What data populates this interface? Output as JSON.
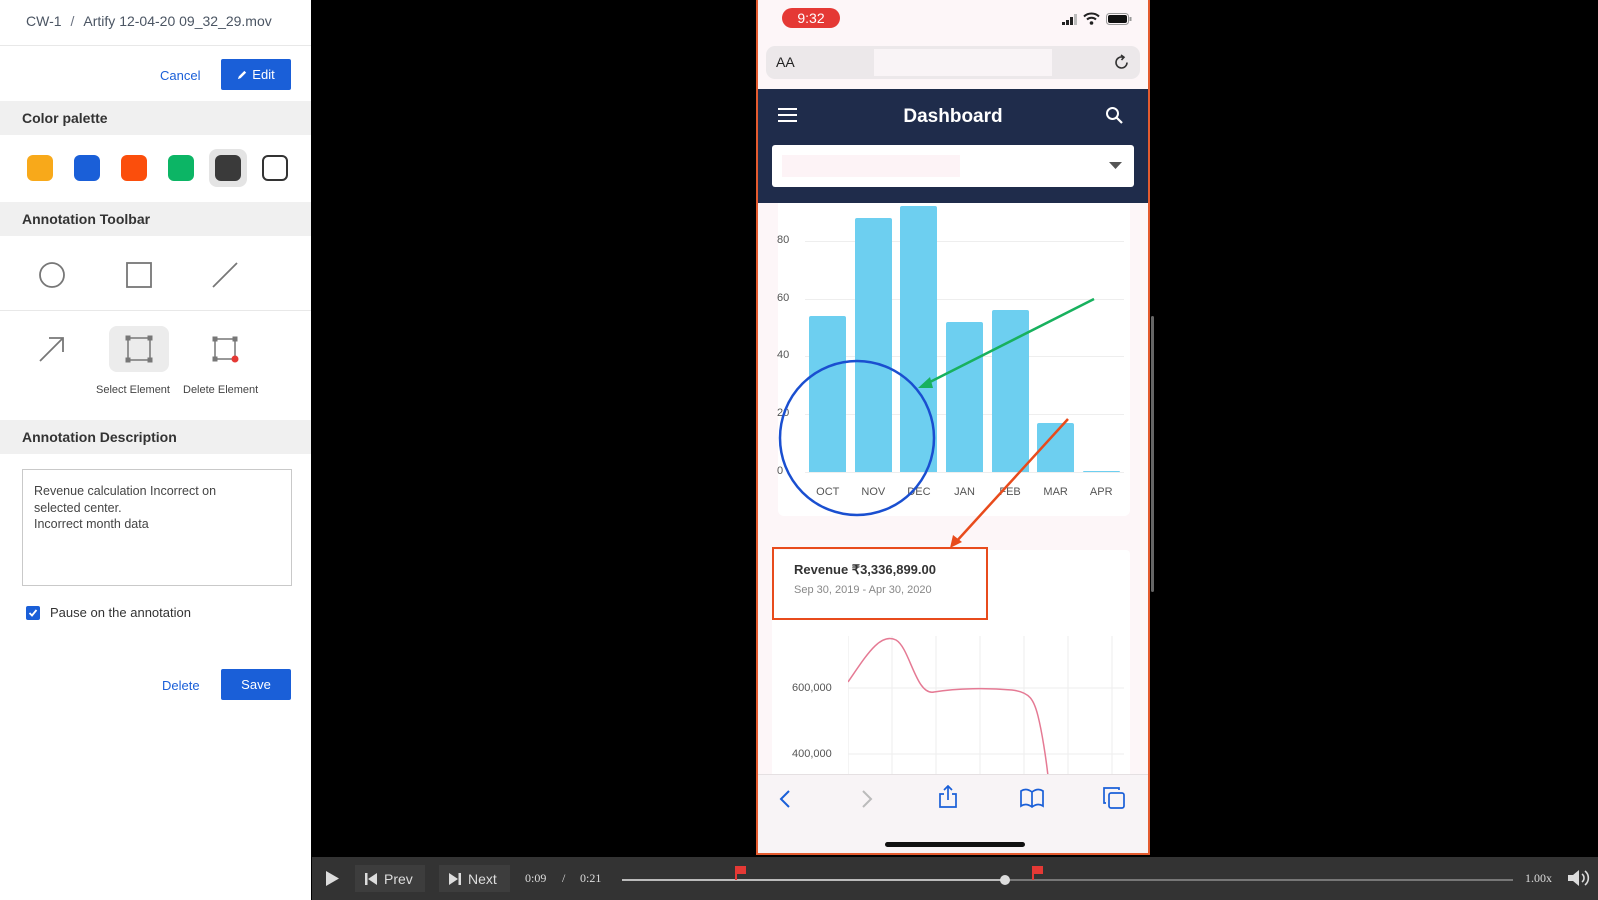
{
  "breadcrumb": {
    "project": "CW-1",
    "separator": "/",
    "file": "Artify 12-04-20 09_32_29.mov"
  },
  "top_actions": {
    "cancel": "Cancel",
    "edit": "Edit"
  },
  "color_palette": {
    "title": "Color palette",
    "colors": [
      "#f8a91a",
      "#1a5fd8",
      "#fb4e0c",
      "#0cb565",
      "#3a3a3a",
      "#ffffff"
    ],
    "selected_index": 4
  },
  "toolbar": {
    "title": "Annotation Toolbar",
    "tools": [
      {
        "name": "circle-tool",
        "label": ""
      },
      {
        "name": "rectangle-tool",
        "label": ""
      },
      {
        "name": "line-tool",
        "label": ""
      },
      {
        "name": "arrow-tool",
        "label": ""
      },
      {
        "name": "select-element-tool",
        "label": "Select Element"
      },
      {
        "name": "delete-element-tool",
        "label": "Delete Element"
      }
    ]
  },
  "description": {
    "title": "Annotation Description",
    "text": "Revenue calculation Incorrect on\nselected center.\nIncorrect month data"
  },
  "pause": {
    "label": "Pause on the annotation",
    "checked": true
  },
  "bottom_actions": {
    "delete": "Delete",
    "save": "Save"
  },
  "phone": {
    "time": "9:32",
    "text_size": "AA",
    "header_title": "Dashboard",
    "revenue_title": "Revenue ₹3,336,899.00",
    "revenue_range": "Sep 30, 2019 - Apr 30, 2020",
    "line_chart_ticks": [
      "600,000",
      "400,000"
    ]
  },
  "chart_data": {
    "type": "bar",
    "categories": [
      "OCT",
      "NOV",
      "DEC",
      "JAN",
      "FEB",
      "MAR",
      "APR"
    ],
    "values": [
      54,
      88,
      92,
      52,
      56,
      17,
      0
    ],
    "ylim": [
      0,
      90
    ],
    "yticks": [
      "80",
      "60",
      "40",
      "20",
      "0"
    ],
    "colors": {
      "bar": "#6dcff0"
    }
  },
  "player": {
    "prev": "Prev",
    "next": "Next",
    "current_time": "0:09",
    "time_separator": "/",
    "duration": "0:21",
    "speed": "1.00x",
    "progress": 0.43
  }
}
